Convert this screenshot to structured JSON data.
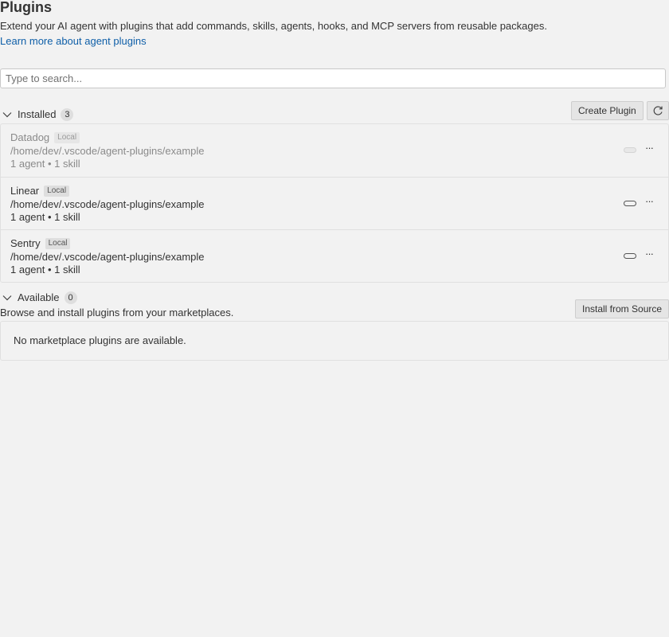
{
  "header": {
    "title": "Plugins",
    "description": "Extend your AI agent with plugins that add commands, skills, agents, hooks, and MCP servers from reusable packages.",
    "learn_more": "Learn more about agent plugins"
  },
  "search": {
    "placeholder": "Type to search...",
    "value": ""
  },
  "installed": {
    "label": "Installed",
    "count": "3",
    "create_button": "Create Plugin",
    "refresh_icon": "refresh-icon",
    "plugins": [
      {
        "name": "Datadog",
        "badge": "Local",
        "path": "/home/dev/.vscode/agent-plugins/example",
        "stats": "1 agent • 1 skill",
        "enabled": false
      },
      {
        "name": "Linear",
        "badge": "Local",
        "path": "/home/dev/.vscode/agent-plugins/example",
        "stats": "1 agent • 1 skill",
        "enabled": true
      },
      {
        "name": "Sentry",
        "badge": "Local",
        "path": "/home/dev/.vscode/agent-plugins/example",
        "stats": "1 agent • 1 skill",
        "enabled": true
      }
    ]
  },
  "available": {
    "label": "Available",
    "count": "0",
    "description": "Browse and install plugins from your marketplaces.",
    "install_button": "Install from Source",
    "empty_message": "No marketplace plugins are available."
  },
  "colors": {
    "background": "#f2f2f2",
    "link": "#0f5fa8",
    "border": "#e0e0e0",
    "button_bg": "#e5e5e5"
  }
}
